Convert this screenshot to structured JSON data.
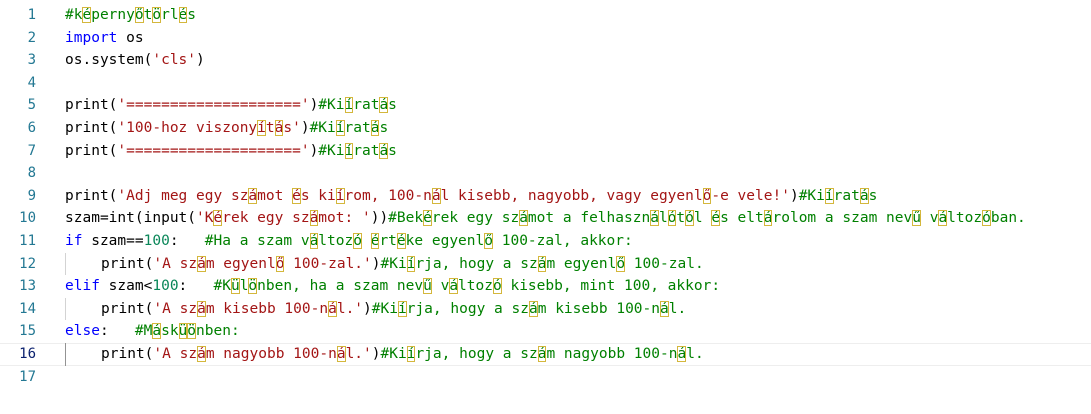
{
  "theme": {
    "keyword": "#0000ff",
    "string": "#a31515",
    "comment": "#008000",
    "number": "#098658",
    "plain": "#000000",
    "line_number": "#237893",
    "line_number_active": "#0b216f",
    "highlight_box": "#d4b73c"
  },
  "editor": {
    "current_line": 16,
    "lines": [
      {
        "n": "1",
        "indent": 0,
        "tokens": [
          [
            "c",
            "#képernyőtörlés"
          ]
        ]
      },
      {
        "n": "2",
        "indent": 0,
        "tokens": [
          [
            "k",
            "import"
          ],
          [
            "p",
            " os"
          ]
        ]
      },
      {
        "n": "3",
        "indent": 0,
        "tokens": [
          [
            "p",
            "os.system("
          ],
          [
            "s",
            "'cls'"
          ],
          [
            "p",
            ")"
          ]
        ]
      },
      {
        "n": "4",
        "indent": 0,
        "tokens": []
      },
      {
        "n": "5",
        "indent": 0,
        "tokens": [
          [
            "p",
            "print("
          ],
          [
            "s",
            "'===================='"
          ],
          [
            "p",
            ")"
          ],
          [
            "c",
            "#Kiíratás"
          ]
        ]
      },
      {
        "n": "6",
        "indent": 0,
        "tokens": [
          [
            "p",
            "print("
          ],
          [
            "s",
            "'100-hoz viszonyítás'"
          ],
          [
            "p",
            ")"
          ],
          [
            "c",
            "#Kiíratás"
          ]
        ]
      },
      {
        "n": "7",
        "indent": 0,
        "tokens": [
          [
            "p",
            "print("
          ],
          [
            "s",
            "'===================='"
          ],
          [
            "p",
            ")"
          ],
          [
            "c",
            "#Kiíratás"
          ]
        ]
      },
      {
        "n": "8",
        "indent": 0,
        "tokens": []
      },
      {
        "n": "9",
        "indent": 0,
        "tokens": [
          [
            "p",
            "print("
          ],
          [
            "s",
            "'Adj meg egy számot és kiírom, 100-nál kisebb, nagyobb, vagy egyenlő-e vele!'"
          ],
          [
            "p",
            ")"
          ],
          [
            "c",
            "#Kiíratás"
          ]
        ]
      },
      {
        "n": "10",
        "indent": 0,
        "tokens": [
          [
            "p",
            "szam=int(input("
          ],
          [
            "s",
            "'Kérek egy számot: '"
          ],
          [
            "p",
            "))"
          ],
          [
            "c",
            "#Bekérek egy számot a felhasználótól és eltárolom a szam nevű változóban."
          ]
        ]
      },
      {
        "n": "11",
        "indent": 0,
        "tokens": [
          [
            "k",
            "if"
          ],
          [
            "p",
            " szam=="
          ],
          [
            "n",
            "100"
          ],
          [
            "p",
            ":   "
          ],
          [
            "c",
            "#Ha a szam változó értéke egyenlő 100-zal, akkor:"
          ]
        ]
      },
      {
        "n": "12",
        "indent": 1,
        "tokens": [
          [
            "p",
            "print("
          ],
          [
            "s",
            "'A szám egyenlő 100-zal.'"
          ],
          [
            "p",
            ")"
          ],
          [
            "c",
            "#Kiírja, hogy a szám egyenlő 100-zal."
          ]
        ]
      },
      {
        "n": "13",
        "indent": 0,
        "tokens": [
          [
            "k",
            "elif"
          ],
          [
            "p",
            " szam<"
          ],
          [
            "n",
            "100"
          ],
          [
            "p",
            ":   "
          ],
          [
            "c",
            "#Különben, ha a szam nevű változó kisebb, mint 100, akkor:"
          ]
        ]
      },
      {
        "n": "14",
        "indent": 1,
        "tokens": [
          [
            "p",
            "print("
          ],
          [
            "s",
            "'A szám kisebb 100-nál.'"
          ],
          [
            "p",
            ")"
          ],
          [
            "c",
            "#Kiírja, hogy a szám kisebb 100-nál."
          ]
        ]
      },
      {
        "n": "15",
        "indent": 0,
        "tokens": [
          [
            "k",
            "else"
          ],
          [
            "p",
            ":   "
          ],
          [
            "c",
            "#Másküönben:"
          ]
        ]
      },
      {
        "n": "16",
        "indent": 1,
        "tokens": [
          [
            "p",
            "print("
          ],
          [
            "s",
            "'A szám nagyobb 100-nál.'"
          ],
          [
            "p",
            ")"
          ],
          [
            "c",
            "#Kiírja, hogy a szám nagyobb 100-nál."
          ]
        ]
      },
      {
        "n": "17",
        "indent": 0,
        "tokens": []
      }
    ]
  }
}
